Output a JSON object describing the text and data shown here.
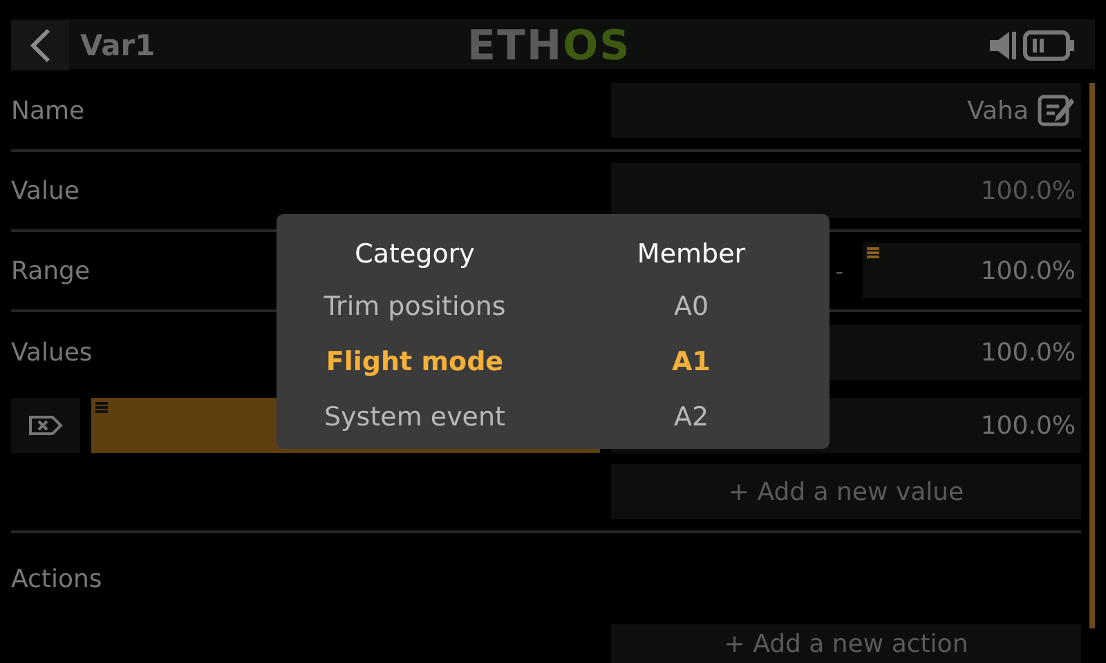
{
  "header": {
    "title": "Var1",
    "logo_left": "ETH",
    "logo_right": "OS"
  },
  "name": {
    "label": "Name",
    "value": "Vaha"
  },
  "value": {
    "label": "Value",
    "value": "100.0%"
  },
  "range": {
    "label": "Range",
    "separator": "-",
    "max": "100.0%"
  },
  "values": {
    "label": "Values",
    "items": [
      {
        "value": "100.0%"
      },
      {
        "value": "100.0%"
      }
    ],
    "add": "+ Add a new value"
  },
  "actions": {
    "label": "Actions",
    "add": "+ Add a new action"
  },
  "popup": {
    "columns": [
      "Category",
      "Member"
    ],
    "rows": [
      {
        "category": "Trim positions",
        "member": "A0",
        "selected": false
      },
      {
        "category": "Flight mode",
        "member": "A1",
        "selected": true
      },
      {
        "category": "System event",
        "member": "A2",
        "selected": false
      }
    ]
  }
}
